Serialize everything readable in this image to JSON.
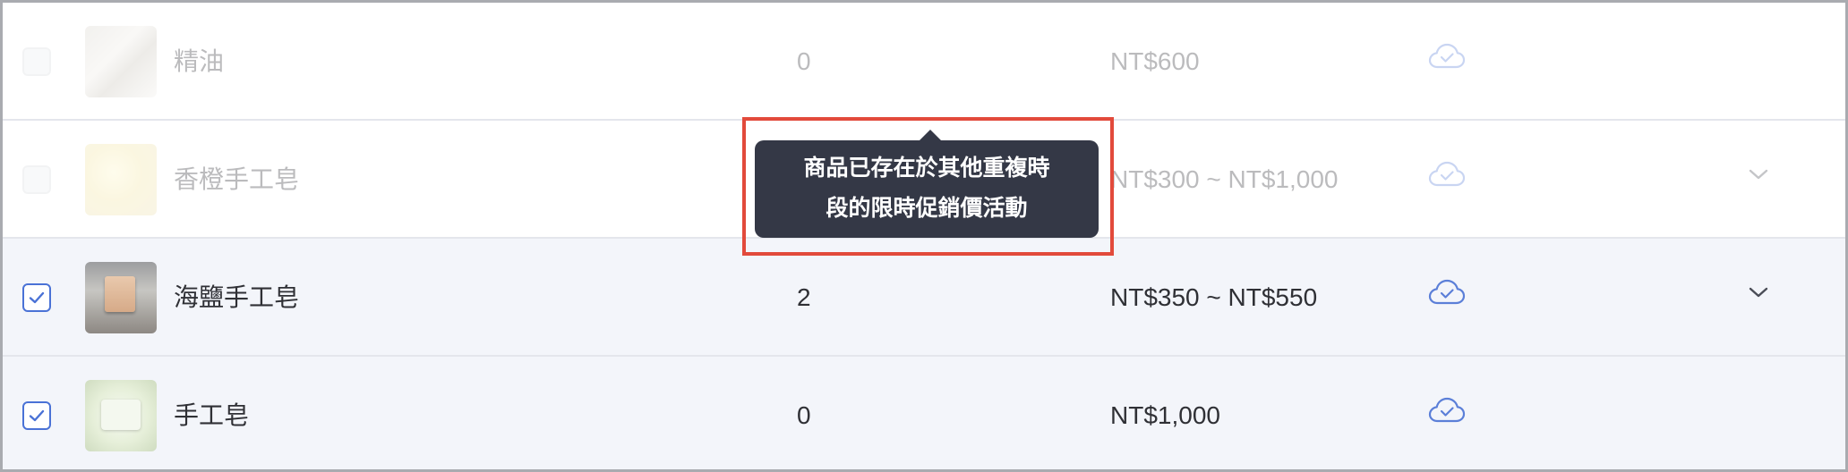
{
  "rows": [
    {
      "name": "精油",
      "quantity": "0",
      "price": "NT$600",
      "checked": false,
      "disabled": true,
      "selected": false,
      "has_chevron": false,
      "thumbnail": "essential-oil-thumbnail",
      "status_icon": "cloud-check-icon"
    },
    {
      "name": "香橙手工皂",
      "quantity": "",
      "price": "NT$300 ~ NT$1,000",
      "checked": false,
      "disabled": true,
      "selected": false,
      "has_chevron": true,
      "thumbnail": "orange-soap-thumbnail",
      "status_icon": "cloud-check-icon"
    },
    {
      "name": "海鹽手工皂",
      "quantity": "2",
      "price": "NT$350 ~ NT$550",
      "checked": true,
      "disabled": false,
      "selected": true,
      "has_chevron": true,
      "thumbnail": "sea-salt-soap-thumbnail",
      "status_icon": "cloud-check-icon"
    },
    {
      "name": "手工皂",
      "quantity": "0",
      "price": "NT$1,000",
      "checked": true,
      "disabled": false,
      "selected": true,
      "has_chevron": false,
      "thumbnail": "handmade-soap-thumbnail",
      "status_icon": "cloud-check-icon"
    }
  ],
  "tooltip": {
    "line1": "商品已存在於其他重複時",
    "line2": "段的限時促銷價活動"
  },
  "colors": {
    "accent": "#4a72d6",
    "tooltip_bg": "#343846",
    "highlight": "#e24a3b",
    "selected_row_bg": "#f3f5fa",
    "text": "#2f3035"
  }
}
